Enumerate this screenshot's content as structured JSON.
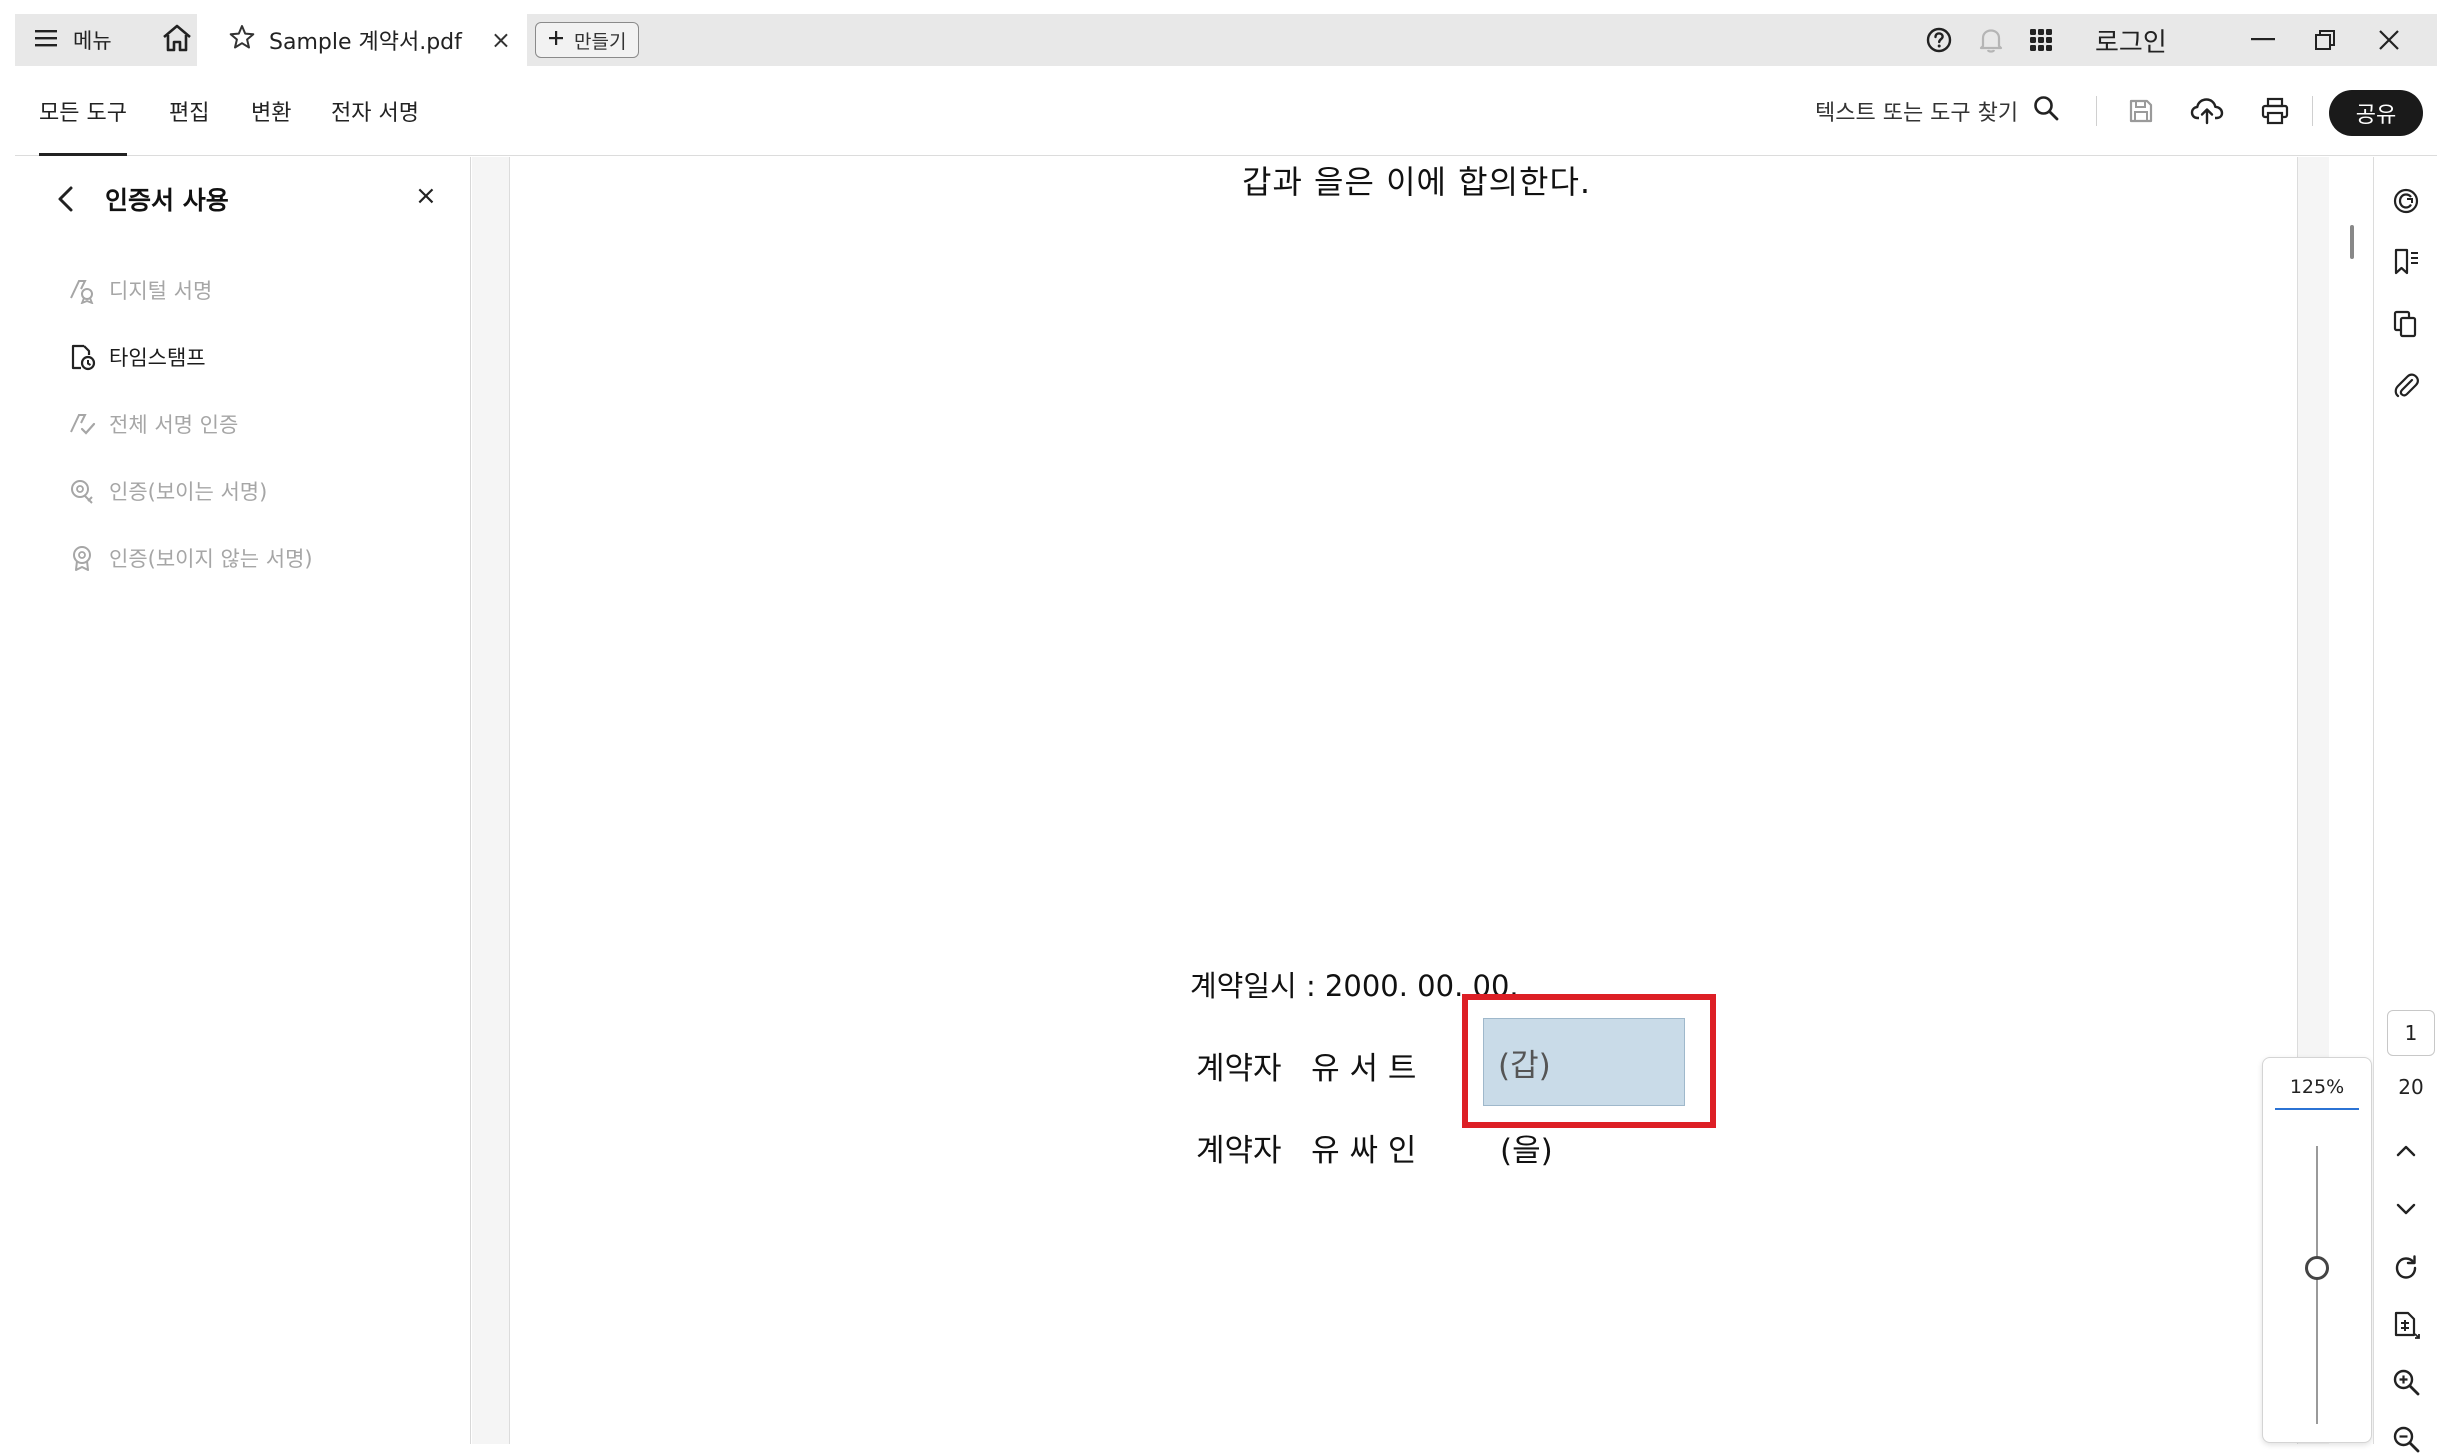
{
  "titlebar": {
    "menu_label": "메뉴",
    "tab_title": "Sample 계약서.pdf",
    "create_label": "만들기",
    "login_label": "로그인"
  },
  "toolbar": {
    "tabs": [
      "모든 도구",
      "편집",
      "변환",
      "전자 서명"
    ],
    "active_tab": "모든 도구",
    "search_label": "텍스트 또는 도구 찾기",
    "share_label": "공유"
  },
  "panel": {
    "title": "인증서 사용",
    "items": [
      {
        "label": "디지털 서명",
        "icon": "digital-signature-icon",
        "enabled": false
      },
      {
        "label": "타임스탬프",
        "icon": "timestamp-icon",
        "enabled": true
      },
      {
        "label": "전체 서명 인증",
        "icon": "validate-signatures-icon",
        "enabled": false
      },
      {
        "label": "인증(보이는 서명)",
        "icon": "certify-visible-icon",
        "enabled": false
      },
      {
        "label": "인증(보이지 않는 서명)",
        "icon": "certify-invisible-icon",
        "enabled": false
      }
    ]
  },
  "document": {
    "agreement_line": "갑과 을은 이에 합의한다.",
    "date_line": "계약일시 : 2000. 00. 00.",
    "party1_line": "계약자   유 서 트",
    "party1_field": "(갑)",
    "party2_line": "계약자   유 싸 인",
    "party2_mark": "(을)"
  },
  "navigation": {
    "current_page": "1",
    "total_pages": "20",
    "zoom": "125%"
  },
  "colors": {
    "highlight": "#dd1f26",
    "field_fill": "#c9dbe8",
    "share_button": "#1a1a1a",
    "zoom_accent": "#2b73d4"
  }
}
